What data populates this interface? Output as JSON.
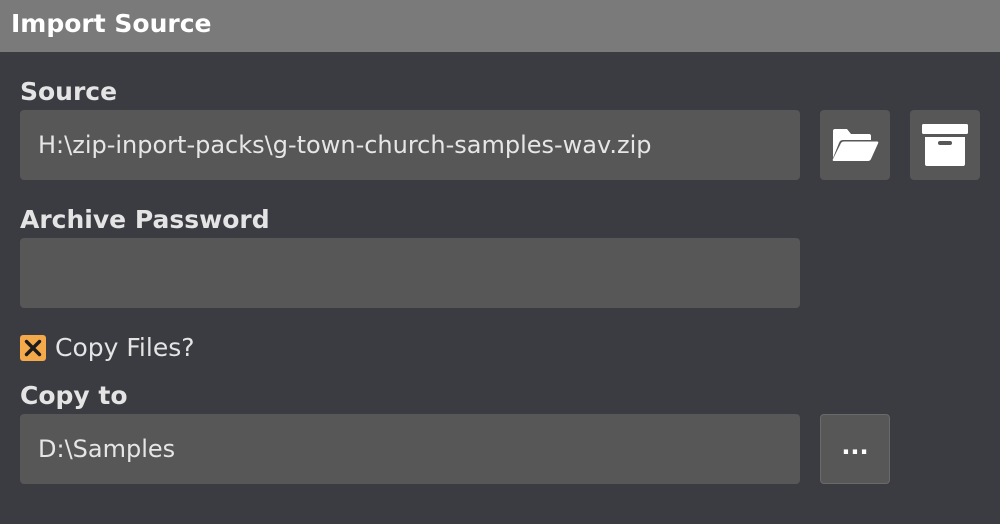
{
  "window": {
    "title": "Import Source"
  },
  "source": {
    "label": "Source",
    "value": "H:\\zip-inport-packs\\g-town-church-samples-wav.zip",
    "open_folder_icon": "folder-open-icon",
    "archive_icon": "archive-box-icon"
  },
  "password": {
    "label": "Archive Password",
    "value": ""
  },
  "copy_files": {
    "label": "Copy Files?",
    "checked": true,
    "accent_color": "#f4a94a"
  },
  "copy_to": {
    "label": "Copy to",
    "value": "D:\\Samples",
    "browse_label": "..."
  }
}
